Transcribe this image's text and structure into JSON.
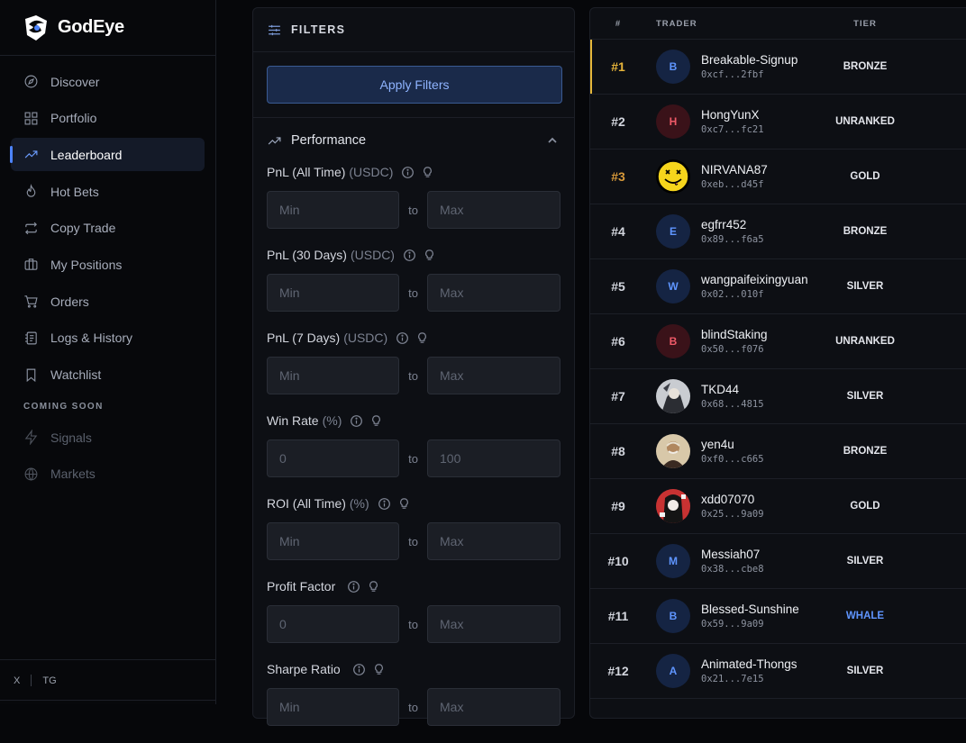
{
  "app": {
    "name": "GodEye"
  },
  "sidebar": {
    "items": [
      {
        "label": "Discover",
        "icon": "compass-icon"
      },
      {
        "label": "Portfolio",
        "icon": "grid-icon"
      },
      {
        "label": "Leaderboard",
        "icon": "trend-icon",
        "active": true
      },
      {
        "label": "Hot Bets",
        "icon": "flame-icon"
      },
      {
        "label": "Copy Trade",
        "icon": "repeat-icon"
      },
      {
        "label": "My Positions",
        "icon": "briefcase-icon"
      },
      {
        "label": "Orders",
        "icon": "cart-icon"
      },
      {
        "label": "Logs & History",
        "icon": "logs-icon"
      },
      {
        "label": "Watchlist",
        "icon": "bookmark-icon"
      }
    ],
    "coming_soon_label": "COMING SOON",
    "coming_soon": [
      {
        "label": "Signals",
        "icon": "bolt-icon"
      },
      {
        "label": "Markets",
        "icon": "globe-icon"
      }
    ],
    "footer": {
      "x": "X",
      "tg": "TG"
    }
  },
  "filters": {
    "title": "FILTERS",
    "apply_label": "Apply Filters",
    "section_title": "Performance",
    "to_label": "to",
    "fields": [
      {
        "label": "PnL (All Time)",
        "unit": "(USDC)",
        "min": "Min",
        "max": "Max"
      },
      {
        "label": "PnL (30 Days)",
        "unit": "(USDC)",
        "min": "Min",
        "max": "Max"
      },
      {
        "label": "PnL (7 Days)",
        "unit": "(USDC)",
        "min": "Min",
        "max": "Max"
      },
      {
        "label": "Win Rate",
        "unit": "(%)",
        "min": "0",
        "max": "100"
      },
      {
        "label": "ROI (All Time)",
        "unit": "(%)",
        "min": "Min",
        "max": "Max"
      },
      {
        "label": "Profit Factor",
        "unit": "",
        "min": "0",
        "max": "Max"
      },
      {
        "label": "Sharpe Ratio",
        "unit": "",
        "min": "Min",
        "max": "Max"
      }
    ]
  },
  "leaderboard": {
    "headers": {
      "rank": "#",
      "trader": "TRADER",
      "tier": "TIER"
    },
    "rows": [
      {
        "rank": "#1",
        "initial": "B",
        "name": "Breakable-Signup",
        "addr": "0xcf...2fbf",
        "tier": "BRONZE",
        "avatar": "blue"
      },
      {
        "rank": "#2",
        "initial": "H",
        "name": "HongYunX",
        "addr": "0xc7...fc21",
        "tier": "UNRANKED",
        "avatar": "red"
      },
      {
        "rank": "#3",
        "initial": "",
        "name": "NIRVANA87",
        "addr": "0xeb...d45f",
        "tier": "GOLD",
        "avatar": "smiley"
      },
      {
        "rank": "#4",
        "initial": "E",
        "name": "egfrr452",
        "addr": "0x89...f6a5",
        "tier": "BRONZE",
        "avatar": "blue"
      },
      {
        "rank": "#5",
        "initial": "W",
        "name": "wangpaifeixingyuan",
        "addr": "0x02...010f",
        "tier": "SILVER",
        "avatar": "blue"
      },
      {
        "rank": "#6",
        "initial": "B",
        "name": "blindStaking",
        "addr": "0x50...f076",
        "tier": "UNRANKED",
        "avatar": "red"
      },
      {
        "rank": "#7",
        "initial": "",
        "name": "TKD44",
        "addr": "0x68...4815",
        "tier": "SILVER",
        "avatar": "img1"
      },
      {
        "rank": "#8",
        "initial": "",
        "name": "yen4u",
        "addr": "0xf0...c665",
        "tier": "BRONZE",
        "avatar": "img2"
      },
      {
        "rank": "#9",
        "initial": "",
        "name": "xdd07070",
        "addr": "0x25...9a09",
        "tier": "GOLD",
        "avatar": "img3"
      },
      {
        "rank": "#10",
        "initial": "M",
        "name": "Messiah07",
        "addr": "0x38...cbe8",
        "tier": "SILVER",
        "avatar": "blue"
      },
      {
        "rank": "#11",
        "initial": "B",
        "name": "Blessed-Sunshine",
        "addr": "0x59...9a09",
        "tier": "WHALE",
        "avatar": "blue"
      },
      {
        "rank": "#12",
        "initial": "A",
        "name": "Animated-Thongs",
        "addr": "0x21...7e15",
        "tier": "SILVER",
        "avatar": "blue"
      }
    ]
  }
}
